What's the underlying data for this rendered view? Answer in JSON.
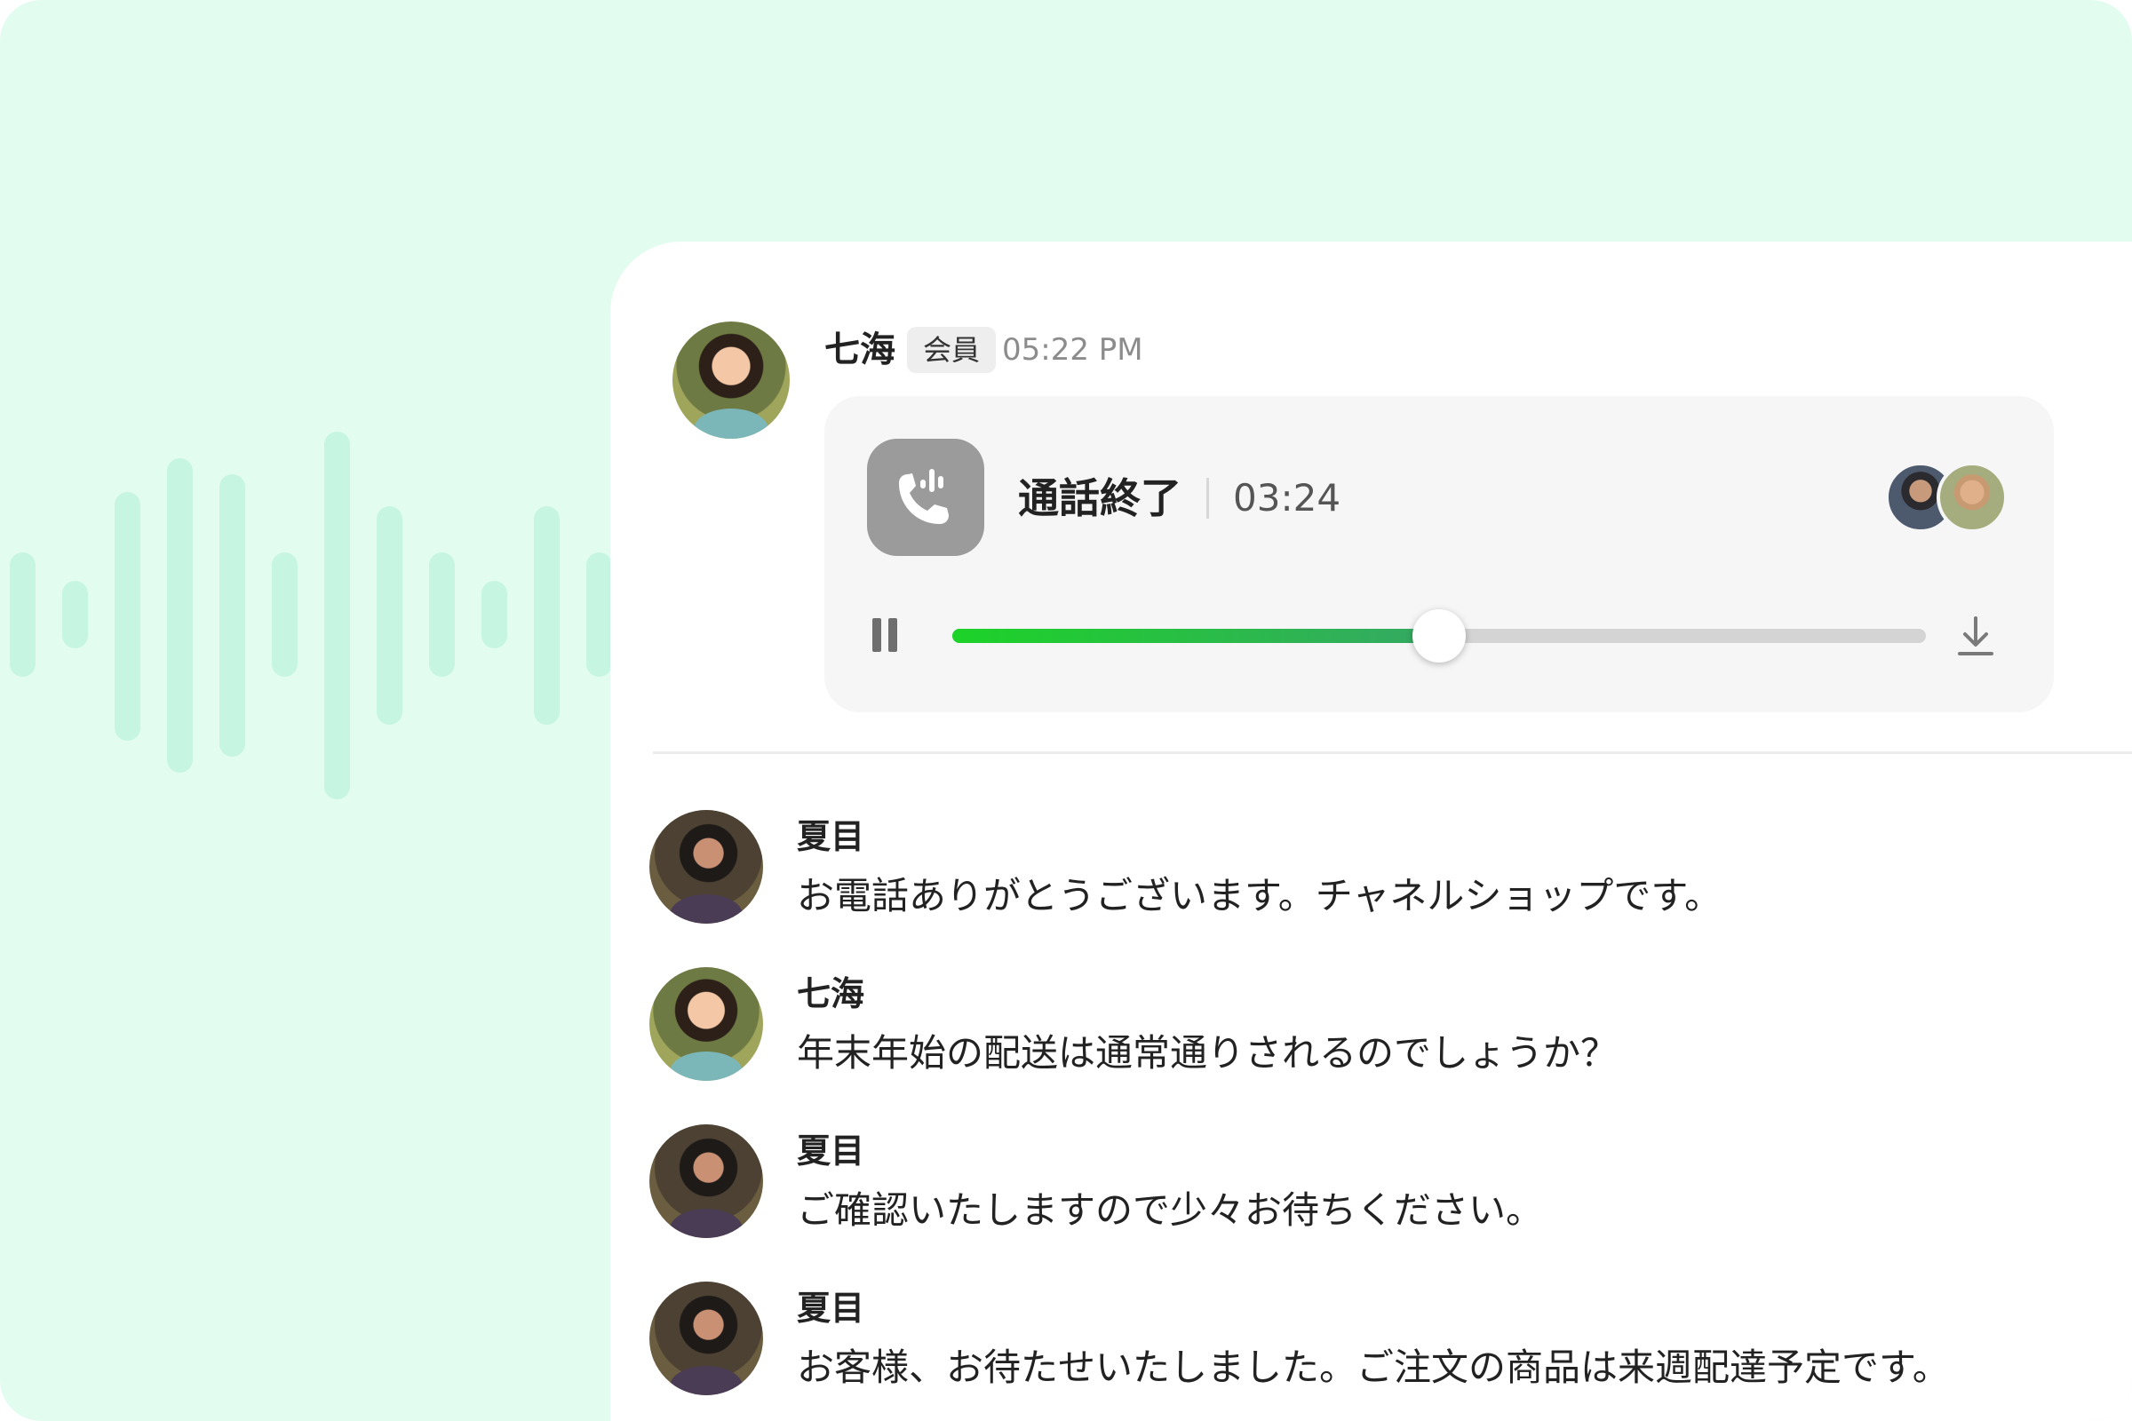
{
  "header_message": {
    "sender": "七海",
    "badge": "会員",
    "time": "05:22 PM"
  },
  "call": {
    "title": "通話終了",
    "duration": "03:24",
    "playback_progress": 0.5,
    "participants": [
      "participant-1",
      "participant-2"
    ]
  },
  "messages": [
    {
      "sender": "夏目",
      "text": "お電話ありがとうございます。チャネルショップです。",
      "avatar": "natsume"
    },
    {
      "sender": "七海",
      "text": "年末年始の配送は通常通りされるのでしょうか？",
      "avatar": "nanami"
    },
    {
      "sender": "夏目",
      "text": "ご確認いたしますので少々お待ちください。",
      "avatar": "natsume"
    },
    {
      "sender": "夏目",
      "text": "お客様、お待たせいたしました。ご注文の商品は来週配達予定です。",
      "avatar": "natsume"
    }
  ],
  "colors": {
    "background": "#e2fcf0",
    "waveform": "#c6f5e2",
    "accent_green_start": "#1dd228",
    "accent_green_end": "#35a864",
    "call_icon_bg": "#9b9b9b"
  }
}
